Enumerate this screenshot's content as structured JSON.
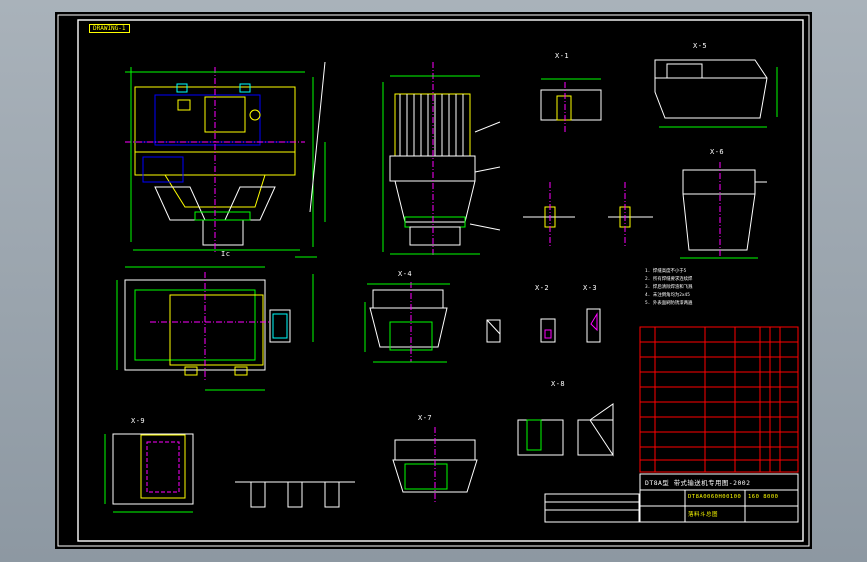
{
  "tab_label": "DRAWING-1",
  "section_label": "Ic",
  "view_labels": [
    "X-1",
    "X-2",
    "X-3",
    "X-4",
    "X-5",
    "X-6",
    "X-7",
    "X-8",
    "X-9"
  ],
  "notes": [
    "1. 焊缝高度不小于5",
    "2. 所有焊缝要求连续焊",
    "3. 焊后清除焊渣和飞溅",
    "4. 未注倒角均为2x45",
    "5. 外表面刷防锈漆两遍"
  ],
  "title_block": {
    "main_title": "DT8A型  带式输送机专用图-2002",
    "drawing_no": "DT8A0060H00100",
    "code": "160 8000",
    "name": "落料斗总图"
  },
  "colors": {
    "sheet_bg": "#000000",
    "line": "#ffffff",
    "outline": "#ffff00",
    "dim": "#00ff00",
    "center": "#ff00ff",
    "hidden": "#0000ff",
    "aux": "#00ffff",
    "table": "#ff0000"
  }
}
